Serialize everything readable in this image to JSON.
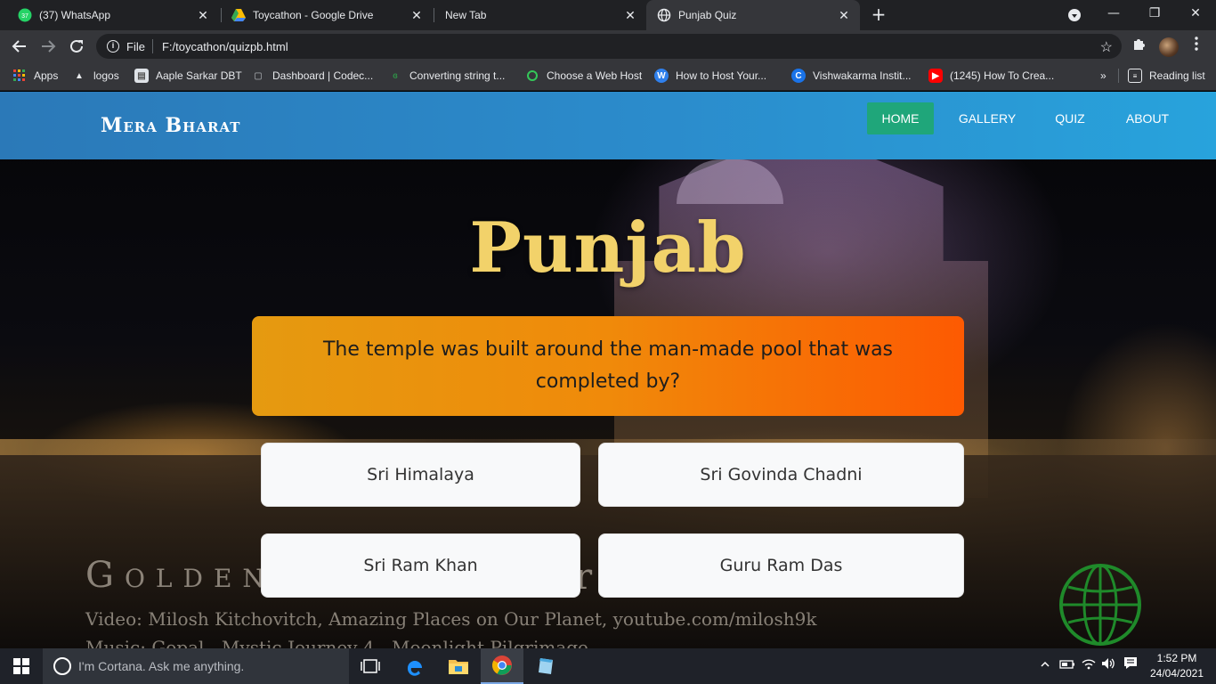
{
  "browser": {
    "tabs": [
      {
        "title": "(37) WhatsApp",
        "badge": "37",
        "close": "✕"
      },
      {
        "title": "Toycathon - Google Drive",
        "close": "✕"
      },
      {
        "title": "New Tab",
        "close": "✕"
      },
      {
        "title": "Punjab Quiz",
        "close": "✕",
        "active": true
      }
    ],
    "new_tab": "+",
    "window_controls": {
      "minimize": "—",
      "restore": "❐",
      "close": "✕"
    },
    "address": {
      "scheme_label": "File",
      "url": "F:/toycathon/quizpb.html"
    },
    "bookmarks": [
      {
        "label": "Apps",
        "icon": "apps-grid-icon"
      },
      {
        "label": "logos",
        "icon": "logos-icon"
      },
      {
        "label": "Aaple Sarkar DBT",
        "icon": "document-icon"
      },
      {
        "label": "Dashboard | Codec...",
        "icon": "codechef-icon"
      },
      {
        "label": "Converting string t...",
        "icon": "gfg-icon"
      },
      {
        "label": "Choose a Web Host",
        "icon": "host-icon"
      },
      {
        "label": "How to Host Your...",
        "icon": "w-icon"
      },
      {
        "label": "Vishwakarma Instit...",
        "icon": "c-icon"
      },
      {
        "label": "(1245) How To Crea...",
        "icon": "youtube-icon"
      }
    ],
    "bookmarks_overflow": "»",
    "reading_list": "Reading list"
  },
  "site": {
    "brand": "Mera Bharat",
    "nav": [
      {
        "label": "HOME",
        "active": true
      },
      {
        "label": "GALLERY"
      },
      {
        "label": "QUIZ"
      },
      {
        "label": "ABOUT"
      }
    ]
  },
  "quiz": {
    "title": "Punjab",
    "question": "The temple was built around the man-made pool that was completed by?",
    "options": [
      "Sri Himalaya",
      "Sri Govinda Chadni",
      "Sri Ram Khan",
      "Guru Ram Das"
    ]
  },
  "background_video": {
    "left_title": "Golden",
    "right_fragment": "r",
    "credit_line1": "Video: Milosh Kitchovitch, Amazing Places on Our Planet, youtube.com/milosh9k",
    "credit_line2": "Music: Gopal - Mystic Journey 4 - Moonlight Pilgrimage"
  },
  "taskbar": {
    "cortana_placeholder": "I'm Cortana. Ask me anything.",
    "clock_time": "1:52 PM",
    "clock_date": "24/04/2021"
  },
  "colors": {
    "navbar_start": "#2b79b8",
    "navbar_end": "#28a3dc",
    "nav_active": "#1fa67a",
    "title_gold": "#f2d26a",
    "question_start": "#e59a10",
    "question_end": "#fd5a02"
  }
}
